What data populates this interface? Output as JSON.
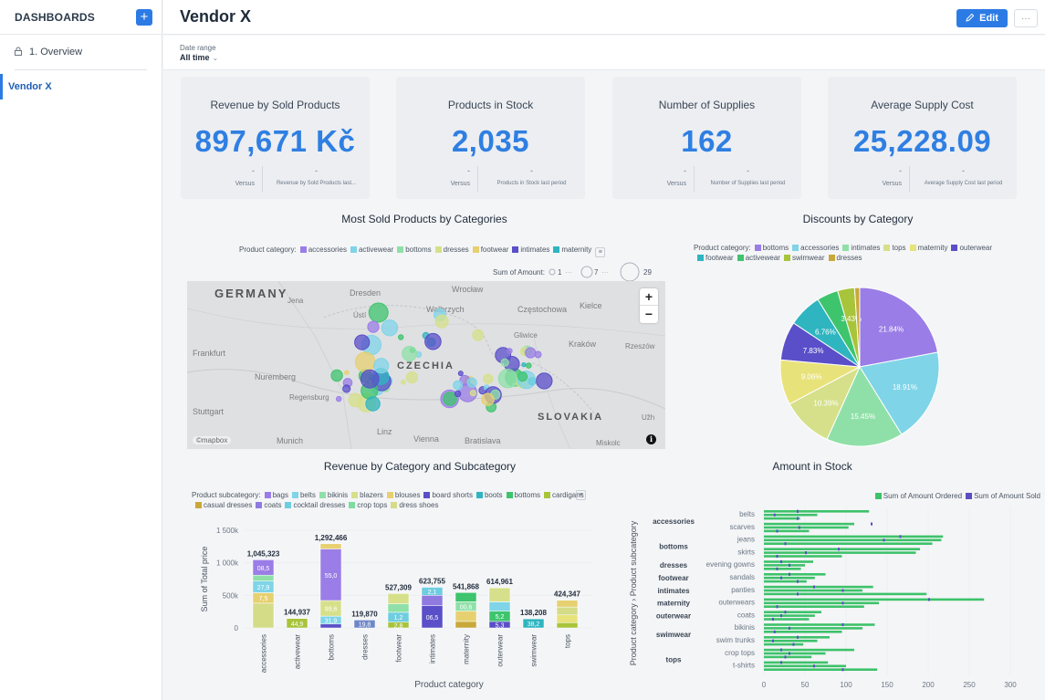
{
  "sidebar": {
    "title": "DASHBOARDS",
    "add_label": "+",
    "overview_label": "1. Overview",
    "active_label": "Vendor X"
  },
  "header": {
    "title": "Vendor X",
    "edit_label": "Edit",
    "more_label": "···"
  },
  "filter": {
    "label": "Date range",
    "value": "All time"
  },
  "kpis": [
    {
      "title": "Revenue by Sold Products",
      "value": "897,671 Kč",
      "dash1": "-",
      "dash2": "-",
      "versus": "Versus",
      "last": "Revenue by Sold Products last..."
    },
    {
      "title": "Products in Stock",
      "value": "2,035",
      "dash1": "-",
      "dash2": "-",
      "versus": "Versus",
      "last": "Products in Stock last period"
    },
    {
      "title": "Number of Supplies",
      "value": "162",
      "dash1": "-",
      "dash2": "-",
      "versus": "Versus",
      "last": "Number of Supplies last period"
    },
    {
      "title": "Average Supply Cost",
      "value": "25,228.09",
      "dash1": "-",
      "dash2": "-",
      "versus": "Versus",
      "last": "Average Supply Cost last period"
    }
  ],
  "colors": {
    "accent": "#2c7be5",
    "kpi_value": "#2f7fe2",
    "accessories": "#9a7de6",
    "activewear": "#7fd4e8",
    "bottoms": "#8fe0a8",
    "dresses": "#d6e08a",
    "footwear": "#e6d070",
    "intimates": "#5a4fc8",
    "maternity": "#2fb5c0",
    "outerwear": "#3ec46d",
    "tops": "#e8e27a",
    "swimwear": "#b9d43a",
    "stock_ordered": "#3dc26a",
    "stock_sold": "#5b4fc0"
  },
  "map": {
    "title": "Most Sold Products by Categories",
    "legend_label": "Product category:",
    "legend_items": [
      "accessories",
      "activewear",
      "bottoms",
      "dresses",
      "footwear",
      "intimates",
      "maternity"
    ],
    "size_label": "Sum of Amount:",
    "size_values": [
      "1",
      "7",
      "29"
    ],
    "place_labels": [
      "GERMANY",
      "Jena",
      "Dresden",
      "Wrocław",
      "Wałbrzych",
      "Częstochowa",
      "Kielce",
      "Ústí",
      "Frankfurt",
      "CZECHIA",
      "Gliwice",
      "Kraków",
      "Rzeszów",
      "Nuremberg",
      "Regensburg",
      "Stuttgart",
      "SLOVAKIA",
      "Munich",
      "Linz",
      "Vienna",
      "Bratislava",
      "Miskolc",
      "Užh"
    ],
    "attribution": "©mapbox",
    "info": "i",
    "zoom_in": "+",
    "zoom_out": "−"
  },
  "pie": {
    "title": "Discounts by Category",
    "legend_label": "Product category:"
  },
  "revenue": {
    "title": "Revenue by Category and Subcategory",
    "legend_label": "Product subcategory:",
    "legend_items": [
      {
        "name": "bags",
        "color": "#9a7de6"
      },
      {
        "name": "belts",
        "color": "#7fd4e8"
      },
      {
        "name": "bikinis",
        "color": "#8fe0a8"
      },
      {
        "name": "blazers",
        "color": "#d6e08a"
      },
      {
        "name": "blouses",
        "color": "#e6d070"
      },
      {
        "name": "board shorts",
        "color": "#5a4fc8"
      },
      {
        "name": "boots",
        "color": "#2fb5c0"
      },
      {
        "name": "bottoms",
        "color": "#3ec46d"
      },
      {
        "name": "cardigans",
        "color": "#a8c43a"
      },
      {
        "name": "casual dresses",
        "color": "#c9a83a"
      },
      {
        "name": "coats",
        "color": "#8f7ae0"
      },
      {
        "name": "cocktail dresses",
        "color": "#6fcde0"
      },
      {
        "name": "crop tops",
        "color": "#7fdca0"
      },
      {
        "name": "dress shoes",
        "color": "#d4dc88"
      }
    ]
  },
  "stock": {
    "title": "Amount in Stock",
    "legend_items": [
      {
        "name": "Sum of Amount Ordered",
        "color": "#3dc26a"
      },
      {
        "name": "Sum of Amount Sold",
        "color": "#5b4fc0"
      }
    ]
  },
  "chart_data": [
    {
      "type": "pie",
      "title": "Discounts by Category",
      "legend": [
        "bottoms",
        "accessories",
        "intimates",
        "tops",
        "maternity",
        "outerwear",
        "footwear",
        "activewear",
        "swimwear",
        "dresses"
      ],
      "legend_colors": [
        "#9a7de6",
        "#7fd4e8",
        "#8fe0a8",
        "#d6e08a",
        "#e8e27a",
        "#5a4fc8",
        "#2fb5c0",
        "#3ec46d",
        "#a8c43a",
        "#c9a83a"
      ],
      "slices": [
        {
          "label": "bottoms",
          "value": 21.84,
          "color": "#9a7de6",
          "text": "21.84%"
        },
        {
          "label": "accessories",
          "value": 18.91,
          "color": "#7fd4e8",
          "text": "18.91%"
        },
        {
          "label": "intimates",
          "value": 15.45,
          "color": "#8fe0a8",
          "text": "15.45%"
        },
        {
          "label": "tops",
          "value": 10.39,
          "color": "#d6e08a",
          "text": "10.39%"
        },
        {
          "label": "maternity",
          "value": 9.06,
          "color": "#e8e27a",
          "text": "9.06%"
        },
        {
          "label": "outerwear",
          "value": 7.83,
          "color": "#5a4fc8",
          "text": "7.83%"
        },
        {
          "label": "footwear",
          "value": 6.76,
          "color": "#2fb5c0",
          "text": "6.76%"
        },
        {
          "label": "activewear",
          "value": 4.3,
          "color": "#3ec46d",
          "text": ""
        },
        {
          "label": "swimwear",
          "value": 3.43,
          "color": "#a8c43a",
          "text": "3.43%"
        },
        {
          "label": "dresses",
          "value": 1.03,
          "color": "#c9a83a",
          "text": ""
        }
      ]
    },
    {
      "type": "bar",
      "title": "Revenue by Category and Subcategory",
      "xlabel": "Product category",
      "ylabel": "Sum of Total price",
      "ylim": [
        0,
        1500000
      ],
      "yticks": [
        "0",
        "500k",
        "1 000k",
        "1 500k"
      ],
      "yticks_values": [
        0,
        500000,
        1000000,
        1500000
      ],
      "categories": [
        "accessories",
        "activewear",
        "bottoms",
        "dresses",
        "footwear",
        "intimates",
        "maternity",
        "outerwear",
        "swimwear",
        "tops"
      ],
      "totals": [
        1045323,
        144937,
        1292466,
        119870,
        527309,
        623755,
        541868,
        614961,
        138208,
        424347
      ],
      "total_labels": [
        "1,045,323",
        "144,937",
        "1,292,466",
        "119,870",
        "527,309",
        "623,755",
        "541,868",
        "614,961",
        "138,208",
        "424,347"
      ],
      "stacks": [
        [
          {
            "v": 380000,
            "c": "#d4dc88",
            "t": ""
          },
          {
            "v": 160000,
            "c": "#e6d070",
            "t": "7,5"
          },
          {
            "v": 180000,
            "c": "#7fd4e8",
            "t": "27,9"
          },
          {
            "v": 90000,
            "c": "#8fe0a8",
            "t": ""
          },
          {
            "v": 235323,
            "c": "#9a7de6",
            "t": "08,5"
          }
        ],
        [
          {
            "v": 144937,
            "c": "#a8c43a",
            "t": "44,9"
          }
        ],
        [
          {
            "v": 60000,
            "c": "#5a4fc8",
            "t": "6,3"
          },
          {
            "v": 120000,
            "c": "#7fd4e8",
            "t": "31,9"
          },
          {
            "v": 240000,
            "c": "#d6e08a",
            "t": "99,6"
          },
          {
            "v": 792466,
            "c": "#9a7de6",
            "t": "55,0"
          },
          {
            "v": 80000,
            "c": "#e6d070",
            "t": ""
          }
        ],
        [
          {
            "v": 119870,
            "c": "#6f87c8",
            "t": "19,8"
          }
        ],
        [
          {
            "v": 90000,
            "c": "#a8c43a",
            "t": "2,8"
          },
          {
            "v": 150000,
            "c": "#6fcde0",
            "t": "1,2"
          },
          {
            "v": 130000,
            "c": "#8fe0a8",
            "t": ""
          },
          {
            "v": 157309,
            "c": "#d6e08a",
            "t": ""
          }
        ],
        [
          {
            "v": 340000,
            "c": "#5a4fc8",
            "t": "06,5"
          },
          {
            "v": 160000,
            "c": "#8f7ae0",
            "t": ""
          },
          {
            "v": 123755,
            "c": "#6fcde0",
            "t": "2,1"
          }
        ],
        [
          {
            "v": 100000,
            "c": "#c9a83a",
            "t": ""
          },
          {
            "v": 160000,
            "c": "#e6d070",
            "t": ""
          },
          {
            "v": 140000,
            "c": "#8fe0a8",
            "t": "00,6"
          },
          {
            "v": 141868,
            "c": "#3ec46d",
            "t": ""
          }
        ],
        [
          {
            "v": 100000,
            "c": "#5a4fc8",
            "t": "5,3"
          },
          {
            "v": 160000,
            "c": "#3ec46d",
            "t": "5,2"
          },
          {
            "v": 140000,
            "c": "#7fd4e8",
            "t": ""
          },
          {
            "v": 214961,
            "c": "#d6e08a",
            "t": ""
          }
        ],
        [
          {
            "v": 138208,
            "c": "#2fb5c0",
            "t": "38,2"
          }
        ],
        [
          {
            "v": 80000,
            "c": "#a8c43a",
            "t": "2,6"
          },
          {
            "v": 120000,
            "c": "#e8e27a",
            "t": ""
          },
          {
            "v": 120000,
            "c": "#d4dc88",
            "t": ""
          },
          {
            "v": 104347,
            "c": "#e6d070",
            "t": ""
          }
        ]
      ]
    },
    {
      "type": "bar",
      "orientation": "horizontal",
      "title": "Amount in Stock",
      "ylabel": "Product category › Product subcategory",
      "xlim": [
        0,
        300
      ],
      "xticks": [
        0,
        50,
        100,
        150,
        200,
        250,
        300
      ],
      "categories": [
        "belts",
        "scarves",
        "jeans",
        "skirts",
        "evening gowns",
        "sandals",
        "panties",
        "outerwears",
        "coats",
        "bikinis",
        "swim trunks",
        "crop tops",
        "t-shirts"
      ],
      "groups": [
        {
          "name": "accessories",
          "start": 0,
          "end": 1
        },
        {
          "name": "bottoms",
          "start": 2,
          "end": 3
        },
        {
          "name": "dresses",
          "start": 4,
          "end": 4
        },
        {
          "name": "footwear",
          "start": 5,
          "end": 5
        },
        {
          "name": "intimates",
          "start": 6,
          "end": 6
        },
        {
          "name": "maternity",
          "start": 7,
          "end": 7
        },
        {
          "name": "outerwear",
          "start": 8,
          "end": 8
        },
        {
          "name": "swimwear",
          "start": 9,
          "end": 10
        },
        {
          "name": "tops",
          "start": 11,
          "end": 12
        }
      ],
      "bars": [
        [
          128,
          65,
          44
        ],
        [
          110,
          103,
          55
        ],
        [
          218,
          216,
          205
        ],
        [
          190,
          185,
          95
        ],
        [
          60,
          50,
          45
        ],
        [
          75,
          62,
          52
        ],
        [
          133,
          120,
          198
        ],
        [
          268,
          140,
          122
        ],
        [
          70,
          62,
          55
        ],
        [
          135,
          120,
          95
        ],
        [
          80,
          65,
          48
        ],
        [
          110,
          75,
          58
        ],
        [
          78,
          100,
          138
        ]
      ],
      "sold_marks": [
        [
          40,
          12,
          40
        ],
        [
          130,
          42,
          15
        ],
        [
          165,
          145,
          25
        ],
        [
          90,
          50,
          15
        ],
        [
          20,
          30,
          15
        ],
        [
          30,
          20,
          40
        ],
        [
          60,
          95,
          40
        ],
        [
          200,
          95,
          15
        ],
        [
          25,
          20,
          10
        ],
        [
          95,
          30,
          12
        ],
        [
          40,
          10,
          35
        ],
        [
          20,
          30,
          25
        ],
        [
          20,
          60,
          95
        ]
      ]
    }
  ]
}
